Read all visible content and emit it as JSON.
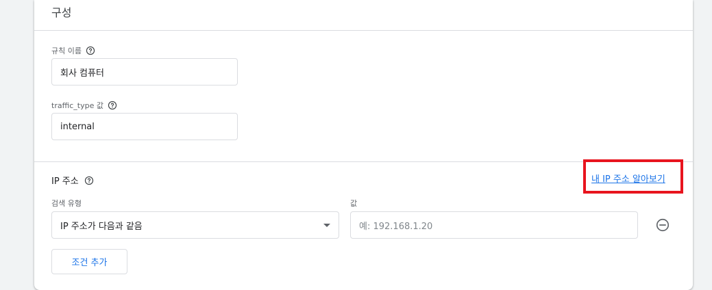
{
  "section": {
    "title": "구성"
  },
  "rule_name": {
    "label": "규칙 이름",
    "value": "회사 컴퓨터"
  },
  "traffic_type": {
    "label": "traffic_type 값",
    "value": "internal"
  },
  "ip_address": {
    "heading": "IP 주소",
    "find_my_ip_link": "내 IP 주소 알아보기",
    "match_type_label": "검색 유형",
    "match_type_selected": "IP 주소가 다음과 같음",
    "value_label": "값",
    "value_placeholder": "예: 192.168.1.20",
    "add_condition_button": "조건 추가"
  },
  "colors": {
    "link": "#1a73e8",
    "highlight_box": "#e8141e",
    "border": "#dadce0"
  },
  "icons": {
    "help": "help-circle-icon",
    "dropdown": "caret-down-icon",
    "remove": "minus-circle-icon"
  }
}
